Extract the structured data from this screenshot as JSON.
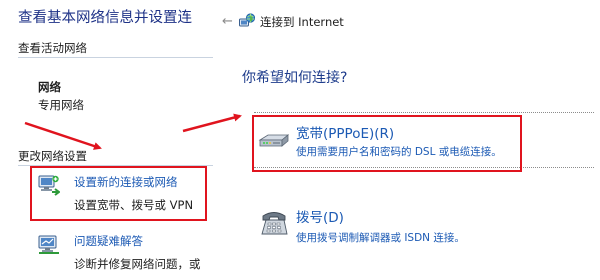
{
  "left": {
    "title": "查看基本网络信息并设置连",
    "active_heading": "查看活动网络",
    "network": {
      "name": "网络",
      "type": "专用网络"
    },
    "change_heading": "更改网络设置",
    "tasks": [
      {
        "link": "设置新的连接或网络",
        "desc": "设置宽带、拨号或 VPN",
        "icon": "network-setup-icon"
      },
      {
        "link": "问题疑难解答",
        "desc": "诊断并修复网络问题，或",
        "icon": "troubleshoot-icon"
      }
    ]
  },
  "wizard": {
    "title": "连接到 Internet",
    "question": "你希望如何连接?",
    "options": [
      {
        "label": "宽带(PPPoE)(R)",
        "desc": "使用需要用户名和密码的 DSL 或电缆连接。",
        "icon": "broadband-modem-icon"
      },
      {
        "label": "拨号(D)",
        "desc": "使用拨号调制解调器或 ISDN 连接。",
        "icon": "dialup-phone-icon"
      }
    ]
  },
  "colors": {
    "link": "#1c5ab4",
    "heading": "#1e3287",
    "annotation": "#e0141e"
  }
}
